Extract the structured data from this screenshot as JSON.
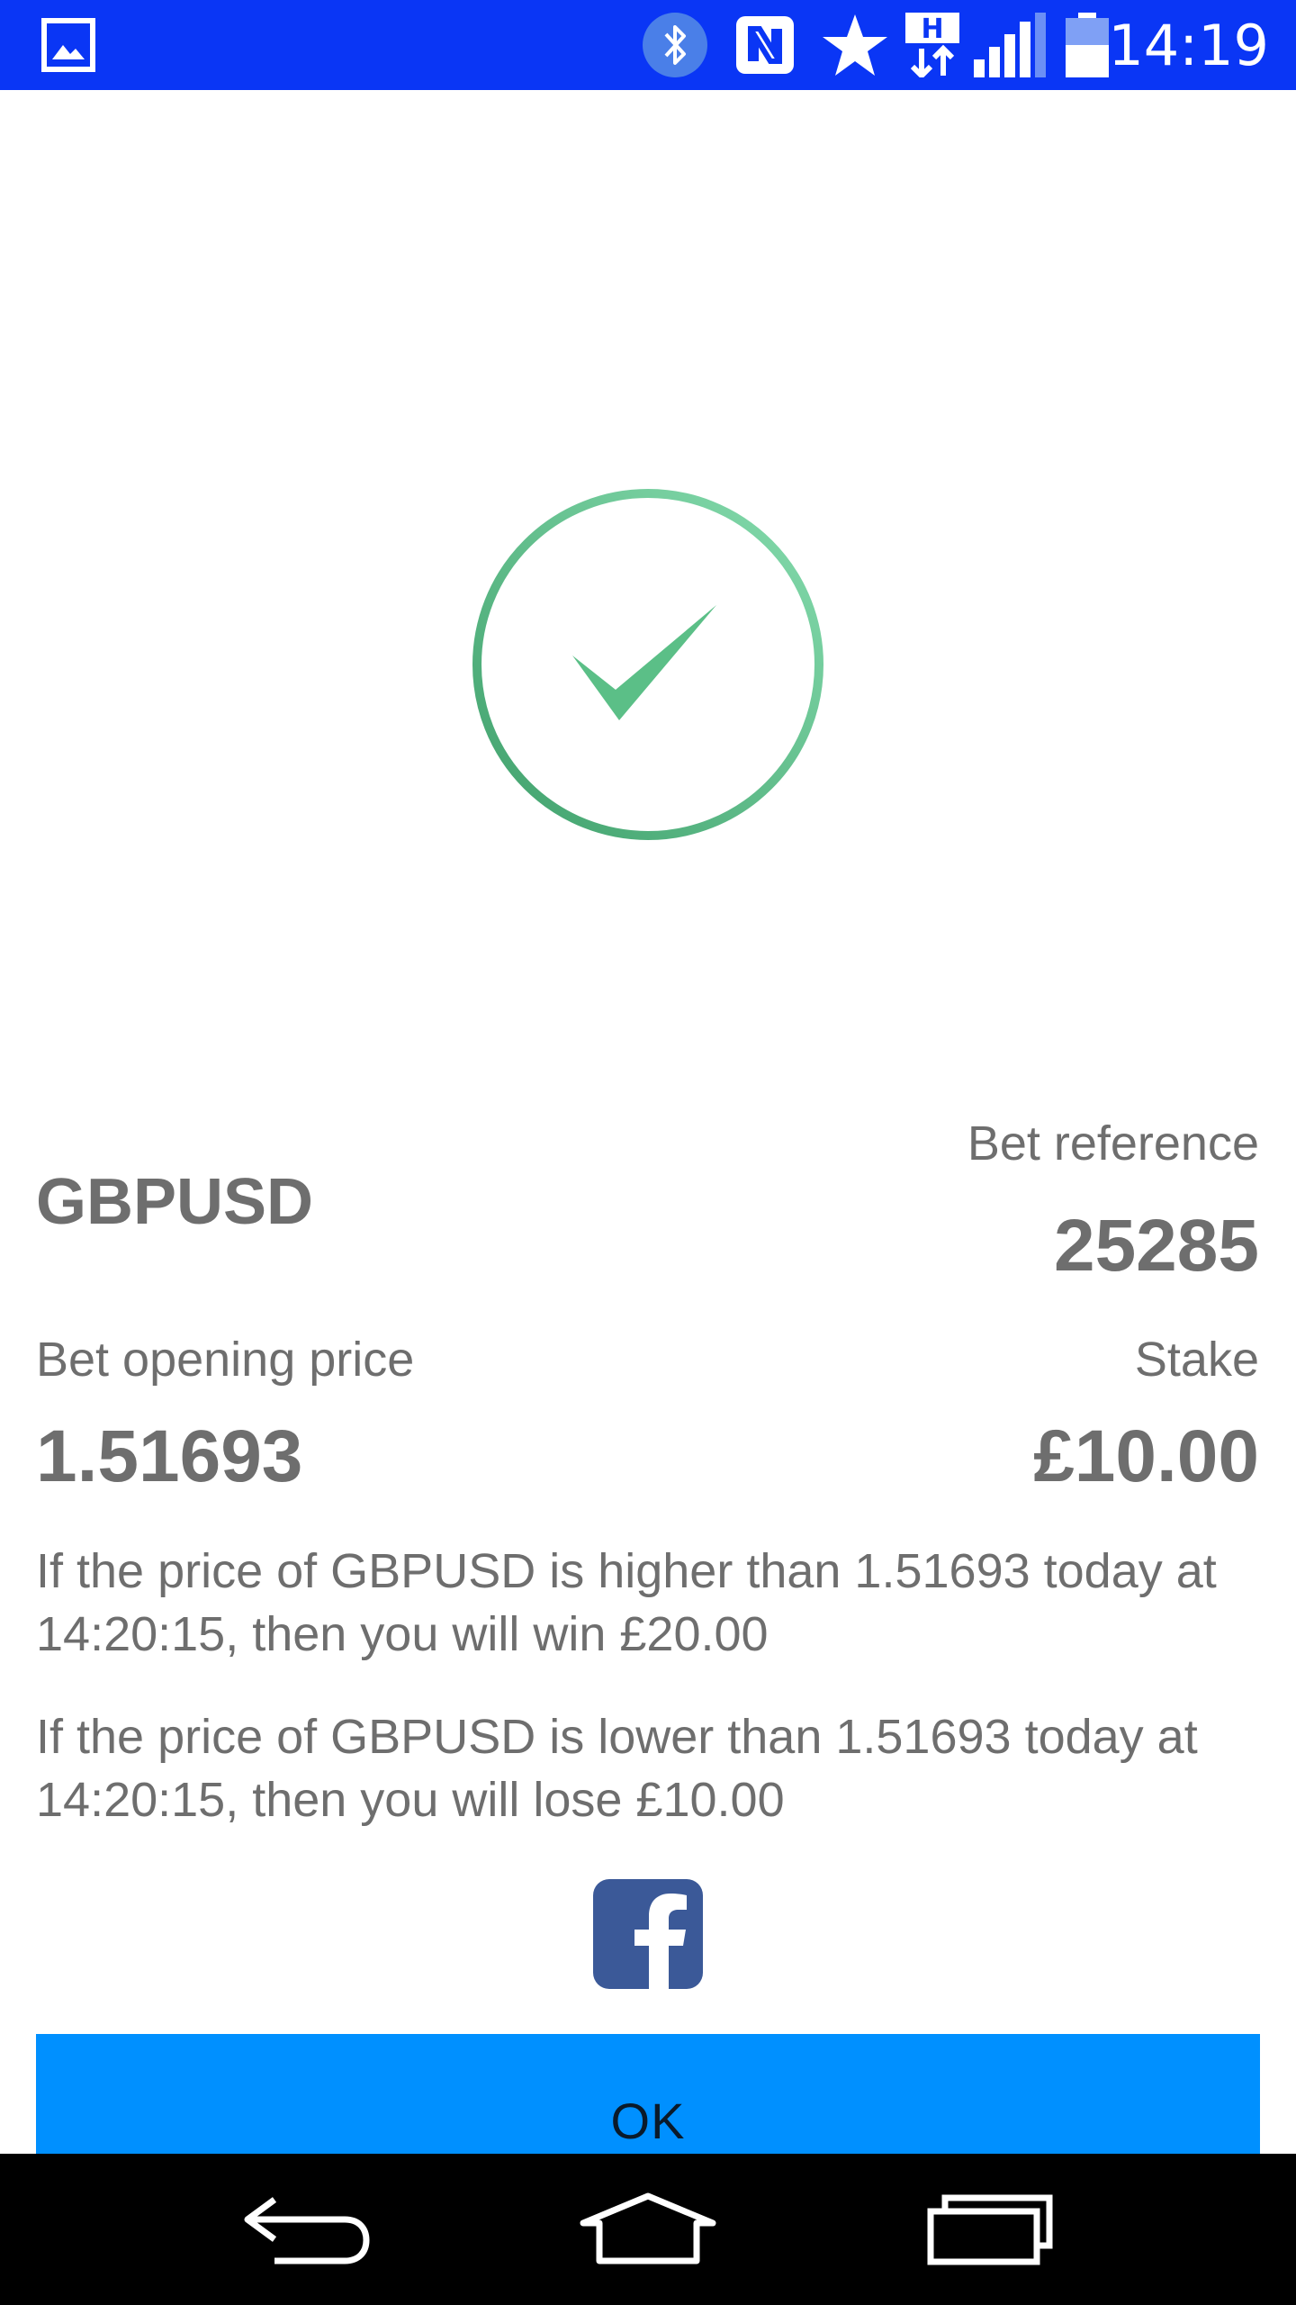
{
  "status_bar": {
    "time": "14:19",
    "icons": [
      "gallery-icon",
      "bluetooth-icon",
      "nfc-icon",
      "star-icon",
      "hsdpa-data-icon",
      "signal-icon",
      "battery-icon"
    ],
    "background_color": "#0a36f5"
  },
  "confirmation": {
    "icon": "check-circle-icon",
    "accent_color": "#5bbf87"
  },
  "bet": {
    "ticker": "GBPUSD",
    "reference_label": "Bet reference",
    "reference_value": "25285",
    "opening_price_label": "Bet opening price",
    "opening_price_value": "1.51693",
    "stake_label": "Stake",
    "stake_value": "£10.00",
    "win_text": "If the price of GBPUSD is higher than 1.51693 today at 14:20:15, then you will win £20.00",
    "lose_text": "If the price of GBPUSD is lower than 1.51693 today at 14:20:15, then you will lose £10.00"
  },
  "share": {
    "icon": "facebook-icon",
    "color": "#3b5998"
  },
  "ok_button": {
    "label": "OK",
    "color": "#0090ff"
  },
  "nav_bar": {
    "icons": [
      "back-icon",
      "home-icon",
      "recents-icon"
    ]
  }
}
